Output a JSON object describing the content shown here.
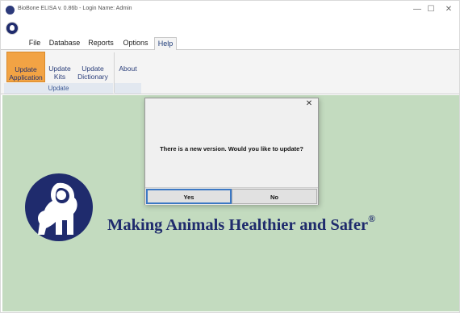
{
  "window": {
    "title": "BioBone ELISA v. 0.86b - Login Name: Admin",
    "minimize_glyph": "—",
    "maximize_glyph": "☐",
    "close_glyph": "✕"
  },
  "tabs": [
    {
      "label": "File"
    },
    {
      "label": "Database"
    },
    {
      "label": "Reports"
    },
    {
      "label": "Options"
    },
    {
      "label": "Help",
      "active": true
    }
  ],
  "ribbon": {
    "buttons": [
      {
        "line1": "Update",
        "line2": "Application",
        "active": true
      },
      {
        "line1": "Update",
        "line2": "Kits"
      },
      {
        "line1": "Update",
        "line2": "Dictionary"
      },
      {
        "line1": "About",
        "line2": ""
      }
    ],
    "group_label": "Update"
  },
  "main": {
    "slogan": "Making Animals Healthier and Safer",
    "slogan_mark": "®",
    "brand_color": "#1f2b6d",
    "background_color": "#c3dbbf"
  },
  "dialog": {
    "close_glyph": "✕",
    "message": "There is a new version. Would you like to update?",
    "yes_label": "Yes",
    "no_label": "No"
  }
}
